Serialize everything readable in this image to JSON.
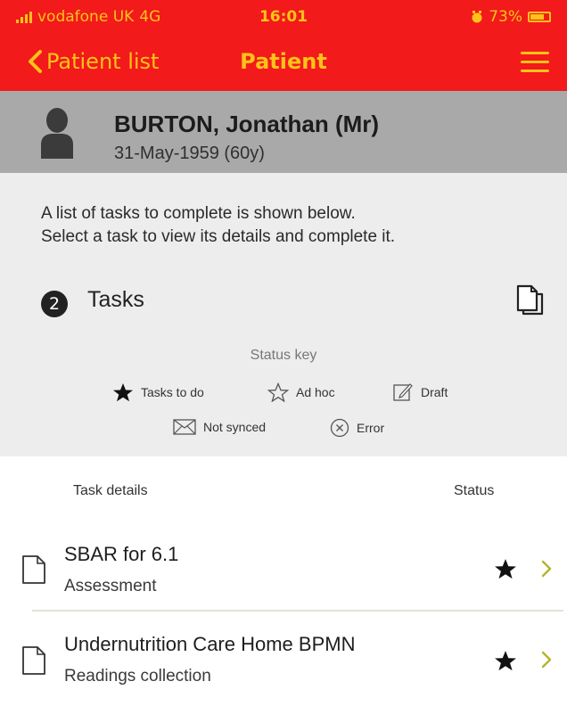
{
  "status_bar": {
    "carrier": "vodafone UK",
    "network": "4G",
    "time": "16:01",
    "battery": "73%"
  },
  "nav": {
    "back_label": "Patient list",
    "title": "Patient"
  },
  "patient": {
    "name": "BURTON, Jonathan (Mr)",
    "dob": "31-May-1959 (60y)"
  },
  "instructions": {
    "line1": "A list of tasks to complete is shown below.",
    "line2": "Select a task to view its details and complete it."
  },
  "tasks_summary": {
    "count": "2",
    "label": "Tasks"
  },
  "status_key": {
    "title": "Status key",
    "items": [
      {
        "icon": "star-filled-icon",
        "label": "Tasks to do"
      },
      {
        "icon": "star-outline-icon",
        "label": "Ad hoc"
      },
      {
        "icon": "draft-icon",
        "label": "Draft"
      },
      {
        "icon": "envelope-icon",
        "label": "Not synced"
      },
      {
        "icon": "error-icon",
        "label": "Error"
      }
    ]
  },
  "table": {
    "col_task": "Task details",
    "col_status": "Status"
  },
  "tasks": [
    {
      "title": "SBAR for 6.1",
      "type": "Assessment",
      "status_icon": "star-filled-icon"
    },
    {
      "title": "Undernutrition Care Home BPMN",
      "type": "Readings collection",
      "status_icon": "star-filled-icon"
    }
  ],
  "colors": {
    "header_red": "#f21a1a",
    "header_text": "#ffc21a",
    "patient_banner": "#a9a9a9",
    "info_background": "#ededed",
    "chevron": "#b5b32a"
  }
}
